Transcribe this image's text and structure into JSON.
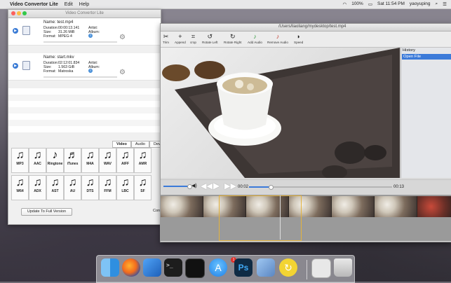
{
  "menubar": {
    "app_name": "Video Convertor Lite",
    "menus": [
      "Edit",
      "Help"
    ],
    "battery": "100%",
    "clock": "Sat 11:54 PM",
    "user": "yaoyuping"
  },
  "app": {
    "title": "Video Convertor Lite",
    "files": [
      {
        "name": "Name: test.mp4",
        "duration_label": "Duration:",
        "duration": "00:00:13.141",
        "size_label": "Size:",
        "size": "31.26 MiB",
        "format_label": "Format:",
        "format": "MPEG-4",
        "artist_label": "Artist:",
        "album_label": "Album:"
      },
      {
        "name": "Name: start.mkv",
        "duration_label": "Duration:",
        "duration": "02:12:01.834",
        "size_label": "Size:",
        "size": "1.563 GiB",
        "format_label": "Format:",
        "format": "Matroska",
        "artist_label": "Artist:",
        "album_label": "Album:"
      }
    ],
    "format_tabs": [
      "Video",
      "Audio",
      "Dev"
    ],
    "formats_row1": [
      "MP3",
      "AAC",
      "Ringtone",
      "iTunes",
      "M4A",
      "WAV",
      "AIFF",
      "AMR"
    ],
    "formats_row2": [
      "W64",
      "ADX",
      "AST",
      "AU",
      "DTS",
      "FFM",
      "LBC",
      "SF"
    ],
    "upgrade_label": "Update To Full Version",
    "convert_label": "Conv"
  },
  "editor": {
    "path": "/Users/liaoliang/mydesktop/test.mp4",
    "tools": [
      "Trim",
      "Append",
      "crop",
      "Rotate Left",
      "Rotate Right",
      "Add Audio",
      "Remove Audio",
      "Speed"
    ],
    "history_title": "History",
    "history_items": [
      "Open File"
    ],
    "time_current": "00:02",
    "time_end": "00:13",
    "seek_fraction": 0.15,
    "volume_fraction": 0.9
  },
  "dock": {
    "icons": [
      "finder-icon",
      "firefox-icon",
      "xcode-icon",
      "terminal-icon",
      "activity-monitor-icon",
      "app-store-icon",
      "photoshop-icon",
      "preview-icon",
      "update-icon",
      "image-capture-icon",
      "trash-icon"
    ],
    "app_store_badge": "1"
  },
  "colors": {
    "accent": "#3b7ad9",
    "selection": "#e3b23c"
  }
}
